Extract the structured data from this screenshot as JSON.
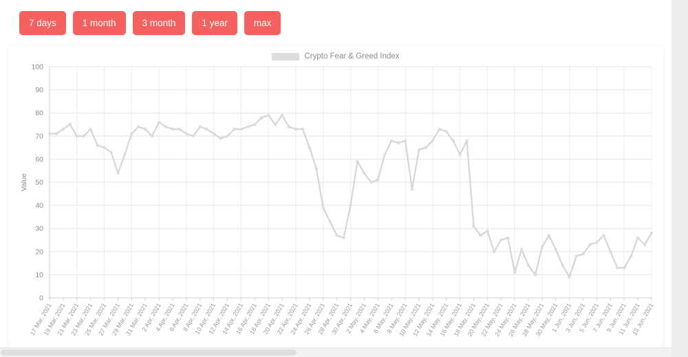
{
  "toolbar": {
    "buttons": [
      {
        "label": "7 days",
        "name": "range-7-days"
      },
      {
        "label": "1 month",
        "name": "range-1-month"
      },
      {
        "label": "3 month",
        "name": "range-3-month"
      },
      {
        "label": "1 year",
        "name": "range-1-year"
      },
      {
        "label": "max",
        "name": "range-max"
      }
    ],
    "accent_color": "#f4615f"
  },
  "chart_data": {
    "type": "line",
    "title": "",
    "legend": [
      "Crypto Fear & Greed Index"
    ],
    "legend_position": "top-center",
    "legend_swatch_color": "#dddddd",
    "line_color": "#d5d5d5",
    "xlabel": "",
    "ylabel": "Value",
    "ylim": [
      0,
      100
    ],
    "ytick_step": 10,
    "yticks": [
      0,
      10,
      20,
      30,
      40,
      50,
      60,
      70,
      80,
      90,
      100
    ],
    "grid": true,
    "x_tick_interval_days": 2,
    "x": [
      "17 Mar, 2021",
      "18 Mar, 2021",
      "19 Mar, 2021",
      "20 Mar, 2021",
      "21 Mar, 2021",
      "22 Mar, 2021",
      "23 Mar, 2021",
      "24 Mar, 2021",
      "25 Mar, 2021",
      "26 Mar, 2021",
      "27 Mar, 2021",
      "28 Mar, 2021",
      "29 Mar, 2021",
      "30 Mar, 2021",
      "31 Mar, 2021",
      "1 Apr, 2021",
      "2 Apr, 2021",
      "3 Apr, 2021",
      "4 Apr, 2021",
      "5 Apr, 2021",
      "6 Apr, 2021",
      "7 Apr, 2021",
      "8 Apr, 2021",
      "9 Apr, 2021",
      "10 Apr, 2021",
      "11 Apr, 2021",
      "12 Apr, 2021",
      "13 Apr, 2021",
      "14 Apr, 2021",
      "15 Apr, 2021",
      "16 Apr, 2021",
      "17 Apr, 2021",
      "18 Apr, 2021",
      "19 Apr, 2021",
      "20 Apr, 2021",
      "21 Apr, 2021",
      "22 Apr, 2021",
      "23 Apr, 2021",
      "24 Apr, 2021",
      "25 Apr, 2021",
      "26 Apr, 2021",
      "27 Apr, 2021",
      "28 Apr, 2021",
      "29 Apr, 2021",
      "30 Apr, 2021",
      "1 May, 2021",
      "2 May, 2021",
      "3 May, 2021",
      "4 May, 2021",
      "5 May, 2021",
      "6 May, 2021",
      "7 May, 2021",
      "8 May, 2021",
      "9 May, 2021",
      "10 May, 2021",
      "11 May, 2021",
      "12 May, 2021",
      "13 May, 2021",
      "14 May, 2021",
      "15 May, 2021",
      "16 May, 2021",
      "17 May, 2021",
      "18 May, 2021",
      "19 May, 2021",
      "20 May, 2021",
      "21 May, 2021",
      "22 May, 2021",
      "23 May, 2021",
      "24 May, 2021",
      "25 May, 2021",
      "26 May, 2021",
      "27 May, 2021",
      "28 May, 2021",
      "29 May, 2021",
      "30 May, 2021",
      "31 May, 2021",
      "1 Jun, 2021",
      "2 Jun, 2021",
      "3 Jun, 2021",
      "4 Jun, 2021",
      "5 Jun, 2021",
      "6 Jun, 2021",
      "7 Jun, 2021",
      "8 Jun, 2021",
      "9 Jun, 2021",
      "10 Jun, 2021",
      "11 Jun, 2021",
      "12 Jun, 2021",
      "13 Jun, 2021"
    ],
    "xtick_labels": [
      "17 Mar, 2021",
      "19 Mar, 2021",
      "21 Mar, 2021",
      "23 Mar, 2021",
      "25 Mar, 2021",
      "27 Mar, 2021",
      "29 Mar, 2021",
      "31 Mar, 2021",
      "2 Apr, 2021",
      "4 Apr, 2021",
      "6 Apr, 2021",
      "8 Apr, 2021",
      "10 Apr, 2021",
      "12 Apr, 2021",
      "14 Apr, 2021",
      "16 Apr, 2021",
      "18 Apr, 2021",
      "20 Apr, 2021",
      "22 Apr, 2021",
      "24 Apr, 2021",
      "26 Apr, 2021",
      "28 Apr, 2021",
      "30 Apr, 2021",
      "2 May, 2021",
      "4 May, 2021",
      "6 May, 2021",
      "8 May, 2021",
      "10 May, 2021",
      "12 May, 2021",
      "14 May, 2021",
      "16 May, 2021",
      "18 May, 2021",
      "20 May, 2021",
      "22 May, 2021",
      "24 May, 2021",
      "26 May, 2021",
      "28 May, 2021",
      "30 May, 2021",
      "1 Jun, 2021",
      "3 Jun, 2021",
      "5 Jun, 2021",
      "7 Jun, 2021",
      "9 Jun, 2021",
      "11 Jun, 2021",
      "13 Jun, 2021"
    ],
    "series": [
      {
        "name": "Crypto Fear & Greed Index",
        "values": [
          71,
          71,
          73,
          75,
          70,
          70,
          73,
          66,
          65,
          63,
          54,
          62,
          71,
          74,
          73,
          70,
          76,
          74,
          73,
          73,
          71,
          70,
          74,
          73,
          71,
          69,
          70,
          73,
          73,
          74,
          75,
          78,
          79,
          75,
          79,
          74,
          73,
          73,
          65,
          56,
          39,
          33,
          27,
          26,
          40,
          59,
          54,
          50,
          51,
          62,
          68,
          67,
          68,
          47,
          64,
          65,
          68,
          73,
          72,
          68,
          62,
          68,
          31,
          27,
          29,
          20,
          25,
          26,
          11,
          21,
          14,
          10,
          22,
          27,
          21,
          14,
          9,
          18,
          19,
          23,
          24,
          27,
          20,
          13,
          13,
          18,
          26,
          23,
          28
        ]
      }
    ]
  }
}
